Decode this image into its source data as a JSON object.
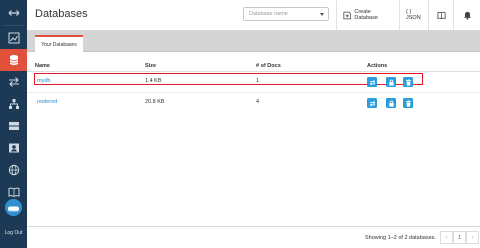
{
  "header": {
    "title": "Databases",
    "search_placeholder": "Database name",
    "create_label": "Create Database",
    "json_label": "{ } JSON"
  },
  "tabs": [
    {
      "label": "Your Databases"
    }
  ],
  "table": {
    "columns": [
      "Name",
      "Size",
      "# of Docs",
      "Actions"
    ],
    "rows": [
      {
        "name": "mydb",
        "size": "1.4 KB",
        "docs": "1"
      },
      {
        "name": "nodered",
        "size": "20.8 KB",
        "docs": "4"
      }
    ]
  },
  "footer": {
    "showing": "Showing 1–2 of 2 databases.",
    "prev": "‹",
    "page": "1",
    "next": "›"
  },
  "sidebar": {
    "items": [
      {
        "icon": "collapse-arrows-icon"
      },
      {
        "icon": "activity-chart-icon"
      },
      {
        "icon": "database-icon",
        "active": true
      },
      {
        "icon": "replication-icon"
      },
      {
        "icon": "network-icon"
      },
      {
        "icon": "server-icon"
      },
      {
        "icon": "user-icon"
      },
      {
        "icon": "globe-icon"
      },
      {
        "icon": "documentation-icon"
      }
    ],
    "logout_label": "Log Out"
  },
  "colors": {
    "sidebar_bg": "#1c3a55",
    "accent": "#e0503a",
    "link": "#2a8fcf",
    "action_button": "#2a9ddb",
    "highlight": "#e01c2a"
  }
}
